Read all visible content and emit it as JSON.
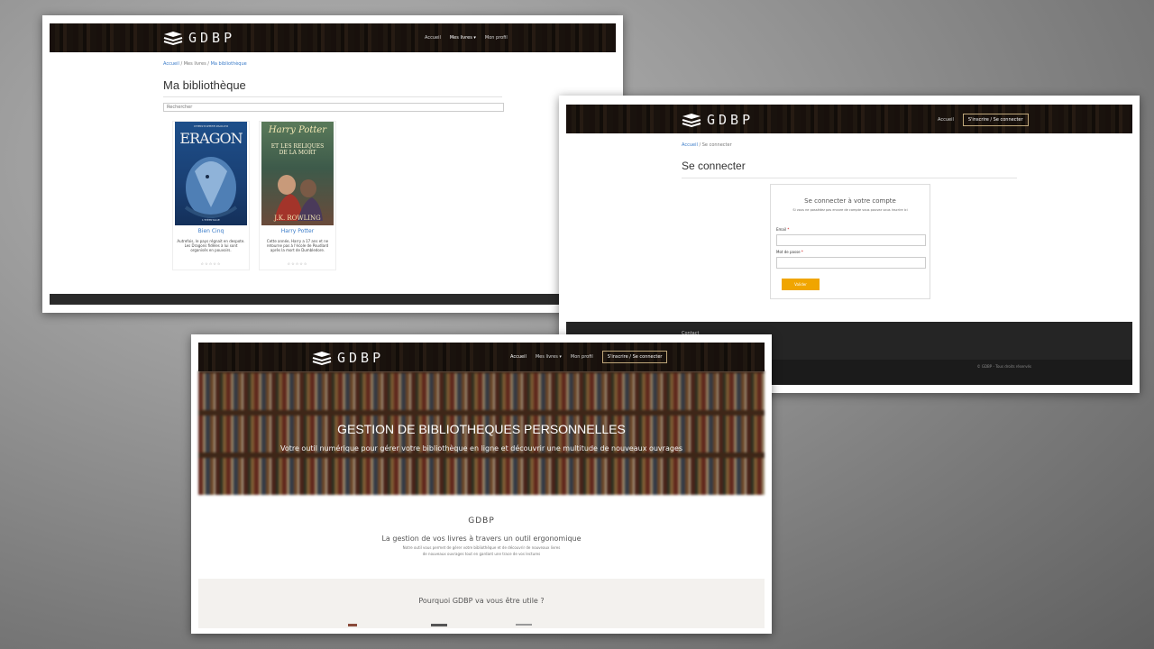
{
  "library": {
    "logo": "GDBP",
    "nav": [
      "Accueil",
      "Mes livres ▾",
      "Mon profil"
    ],
    "breadcrumb": [
      "Accueil",
      "Mes livres",
      "Ma bibliothèque"
    ],
    "title": "Ma bibliothèque",
    "search_placeholder": "Rechercher",
    "books": [
      {
        "cover_top": "CHRISTOPHER PAOLINI",
        "cover_title": "ERAGON",
        "cover_bottom": "L'HÉRITAGE",
        "title": "Bien Cinq",
        "desc": "Autrefois, le pays régnait en despote. Les Dragons fidèles à lui sont organisés en pouvoirs.",
        "stars": "☆☆☆☆☆"
      },
      {
        "cover_top": "Harry Potter",
        "cover_title": "ET LES RELIQUES DE LA MORT",
        "cover_bottom": "J.K. ROWLING",
        "title": "Harry Potter",
        "desc": "Cette année, Harry a 17 ans et ne retourne pas à l'école de Poudlard après la mort de Dumbledore.",
        "stars": "☆☆☆☆☆"
      }
    ]
  },
  "login": {
    "logo": "GDBP",
    "nav": [
      "Accueil"
    ],
    "nav_button": "S'inscrire / Se connecter",
    "breadcrumb": [
      "Accueil",
      "Se connecter"
    ],
    "title": "Se connecter",
    "card_title": "Se connecter à votre compte",
    "card_sub": "Si vous ne possédez pas encore de compte vous pouvez vous inscrire ici",
    "email_label": "Email",
    "password_label": "Mot de passe",
    "required_mark": "*",
    "submit": "Valider",
    "footer_heading": "Contact",
    "footer_copy": "© GDBP - Tous droits réservés"
  },
  "home": {
    "logo": "GDBP",
    "nav": [
      "Accueil",
      "Mes livres ▾",
      "Mon profil"
    ],
    "nav_button": "S'inscrire / Se connecter",
    "hero_title": "GESTION DE BIBLIOTHEQUES PERSONNELLES",
    "hero_sub": "Votre outil numérique pour gérer votre bibliothèque en ligne et découvrir une multitude de nouveaux ouvrages",
    "section_title": "GDBP",
    "tagline": "La gestion de vos livres à travers un outil ergonomique",
    "tagline_small_1": "Notre outil vous permet de gérer votre bibliothèque et de découvrir de nouveaux livres",
    "tagline_small_2": "de nouveaux ouvrages tout en gardant une trace de vos lectures",
    "why_title": "Pourquoi GDBP va vous être utile ?"
  }
}
